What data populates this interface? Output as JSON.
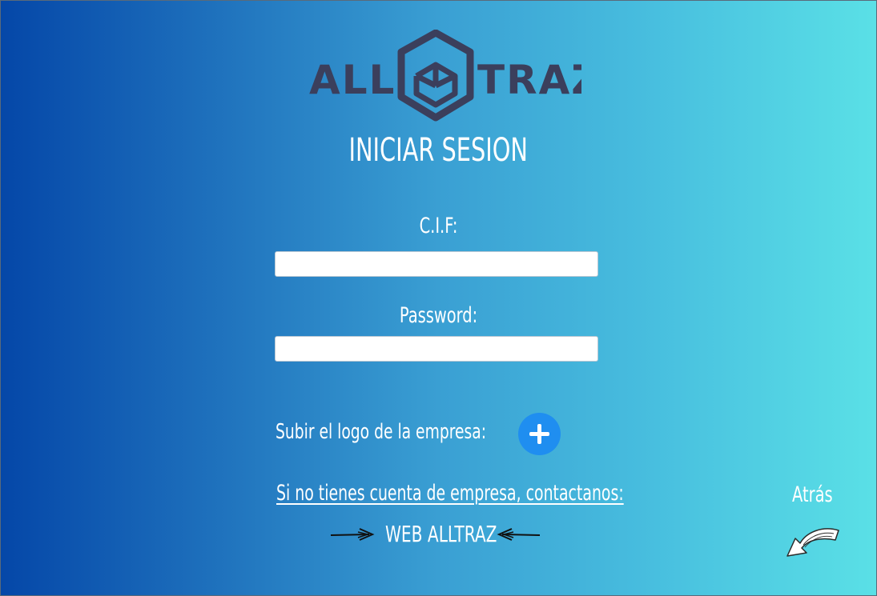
{
  "brand": {
    "logo_left": "ALL",
    "logo_right": "TRAZ",
    "logo_color": "#3b3f5c"
  },
  "login": {
    "title": "INICIAR SESION",
    "cif_label": "C.I.F:",
    "cif_value": "",
    "password_label": "Password:",
    "password_value": ""
  },
  "upload": {
    "label": "Subir el logo de la empresa:",
    "button_icon": "plus-icon",
    "button_color": "#1f8ef0"
  },
  "contact": {
    "text": "Si no tienes cuenta de empresa, contactanos:",
    "web_link": "WEB ALLTRAZ"
  },
  "navigation": {
    "back_label": "Atrás",
    "back_icon": "curved-back-arrow-icon"
  },
  "colors": {
    "gradient_start": "#0547a8",
    "gradient_end": "#5ae0e6",
    "text": "#ffffff"
  }
}
